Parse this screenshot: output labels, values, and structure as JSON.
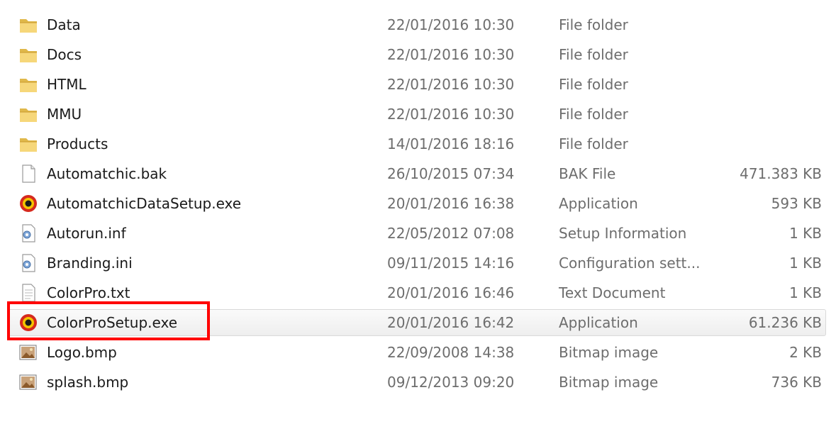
{
  "files": [
    {
      "name": "Data",
      "date": "22/01/2016 10:30",
      "type": "File folder",
      "size": "",
      "icon": "folder-icon"
    },
    {
      "name": "Docs",
      "date": "22/01/2016 10:30",
      "type": "File folder",
      "size": "",
      "icon": "folder-icon"
    },
    {
      "name": "HTML",
      "date": "22/01/2016 10:30",
      "type": "File folder",
      "size": "",
      "icon": "folder-icon"
    },
    {
      "name": "MMU",
      "date": "22/01/2016 10:30",
      "type": "File folder",
      "size": "",
      "icon": "folder-icon"
    },
    {
      "name": "Products",
      "date": "14/01/2016 18:16",
      "type": "File folder",
      "size": "",
      "icon": "folder-icon"
    },
    {
      "name": "Automatchic.bak",
      "date": "26/10/2015 07:34",
      "type": "BAK File",
      "size": "471.383 KB",
      "icon": "blank-file-icon"
    },
    {
      "name": "AutomatchicDataSetup.exe",
      "date": "20/01/2016 16:38",
      "type": "Application",
      "size": "593 KB",
      "icon": "setup-exe-icon"
    },
    {
      "name": "Autorun.inf",
      "date": "22/05/2012 07:08",
      "type": "Setup Information",
      "size": "1 KB",
      "icon": "settings-file-icon"
    },
    {
      "name": "Branding.ini",
      "date": "09/11/2015 14:16",
      "type": "Configuration sett...",
      "size": "1 KB",
      "icon": "settings-file-icon"
    },
    {
      "name": "ColorPro.txt",
      "date": "20/01/2016 16:46",
      "type": "Text Document",
      "size": "1 KB",
      "icon": "text-file-icon"
    },
    {
      "name": "ColorProSetup.exe",
      "date": "20/01/2016 16:42",
      "type": "Application",
      "size": "61.236 KB",
      "icon": "setup-exe-icon"
    },
    {
      "name": "Logo.bmp",
      "date": "22/09/2008 14:38",
      "type": "Bitmap image",
      "size": "2 KB",
      "icon": "bitmap-file-icon"
    },
    {
      "name": "splash.bmp",
      "date": "09/12/2013 09:20",
      "type": "Bitmap image",
      "size": "736 KB",
      "icon": "bitmap-file-icon"
    }
  ],
  "selected_index": 10,
  "colors": {
    "highlight_border": "#ff0000",
    "primary_text": "#1a1a1a",
    "secondary_text": "#6d6d6d"
  }
}
